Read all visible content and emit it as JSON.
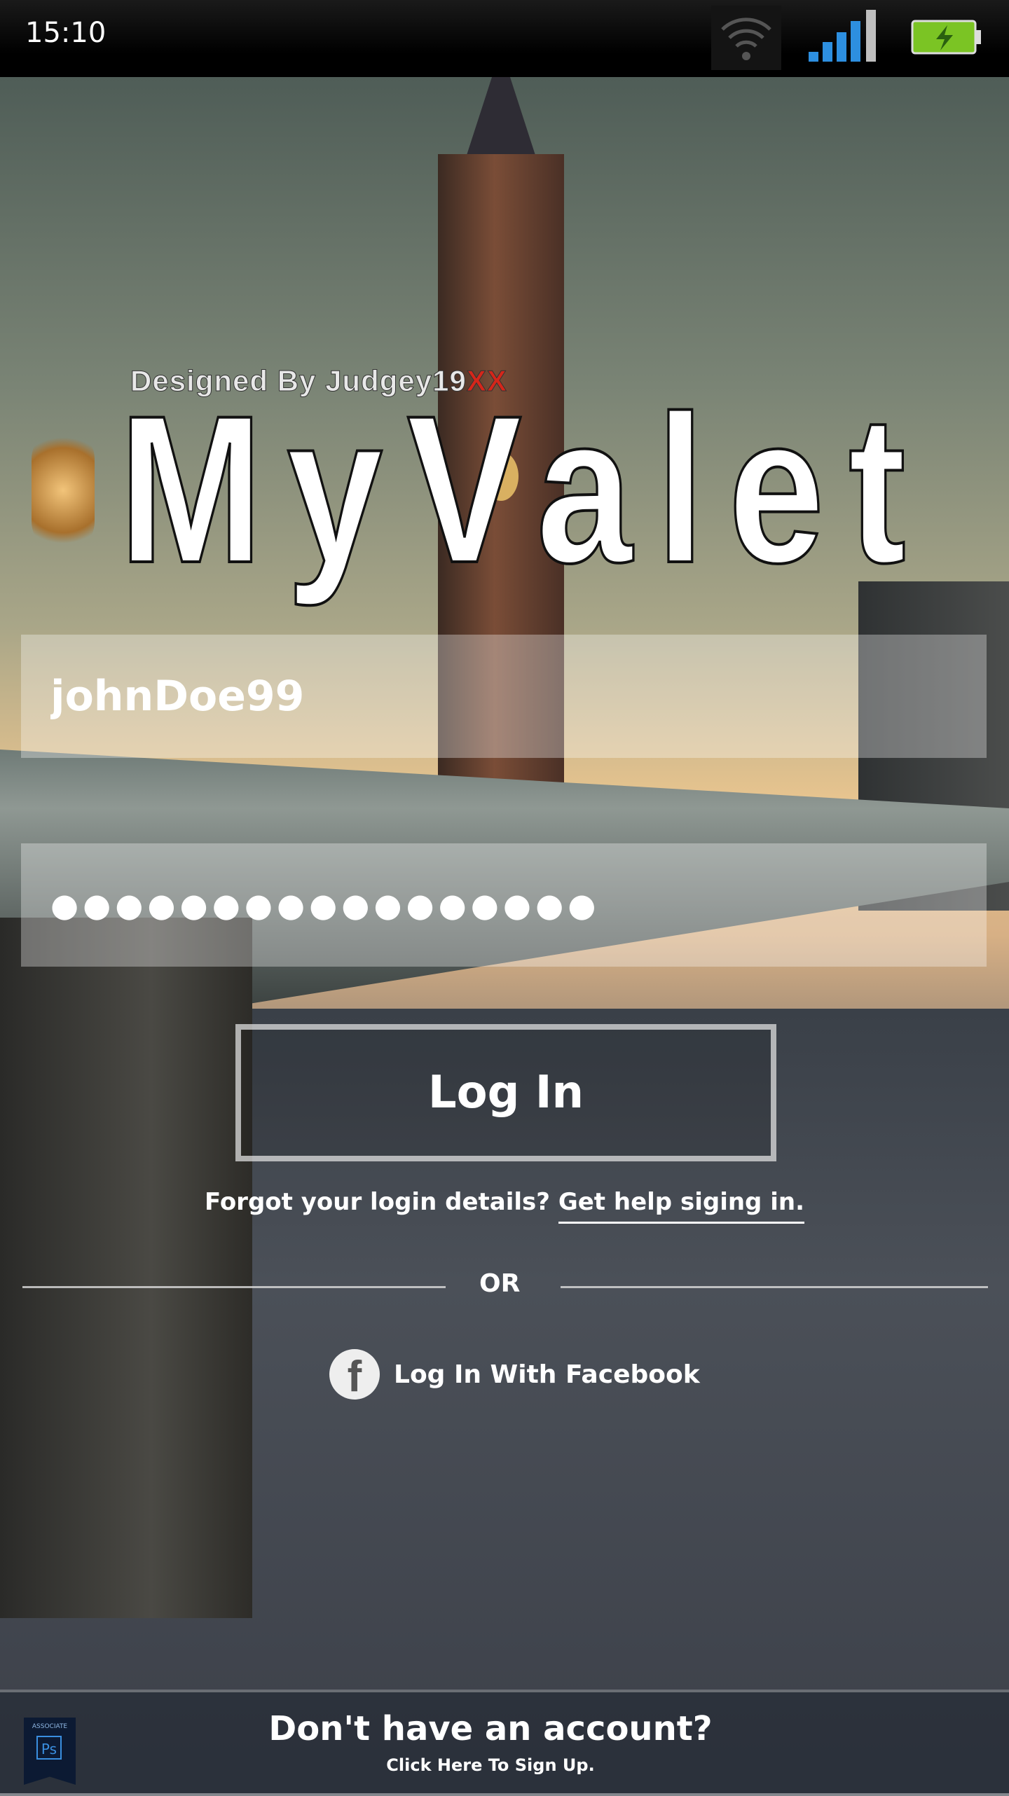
{
  "status_bar": {
    "time": "15:10",
    "icons": [
      "wifi-icon",
      "signal-icon",
      "battery-charging-icon"
    ]
  },
  "branding": {
    "designed_by": "Designed By Judgey19",
    "designed_by_accent": "XX",
    "title": "MyValet"
  },
  "login_form": {
    "username_value": "johnDoe99",
    "password_value": "●●●●●●●●●●●●●●●●●",
    "login_label": "Log In"
  },
  "help": {
    "forgot_text": "Forgot your login details?",
    "help_link": "Get help siging in."
  },
  "divider": {
    "or_text": "OR"
  },
  "facebook": {
    "icon": "facebook-icon",
    "label": "Log In With Facebook",
    "glyph": "f"
  },
  "footer": {
    "signup_title": "Don't have an account?",
    "signup_subtitle": "Click Here To Sign Up.",
    "badge_caption": "ASSOCIATE",
    "badge_mark": "Ps"
  },
  "colors": {
    "accent_red": "#d4261a",
    "field_overlay": "rgba(255,255,255,0.32)",
    "battery_green": "#7bc424",
    "signal_blue": "#2d8fe0"
  }
}
